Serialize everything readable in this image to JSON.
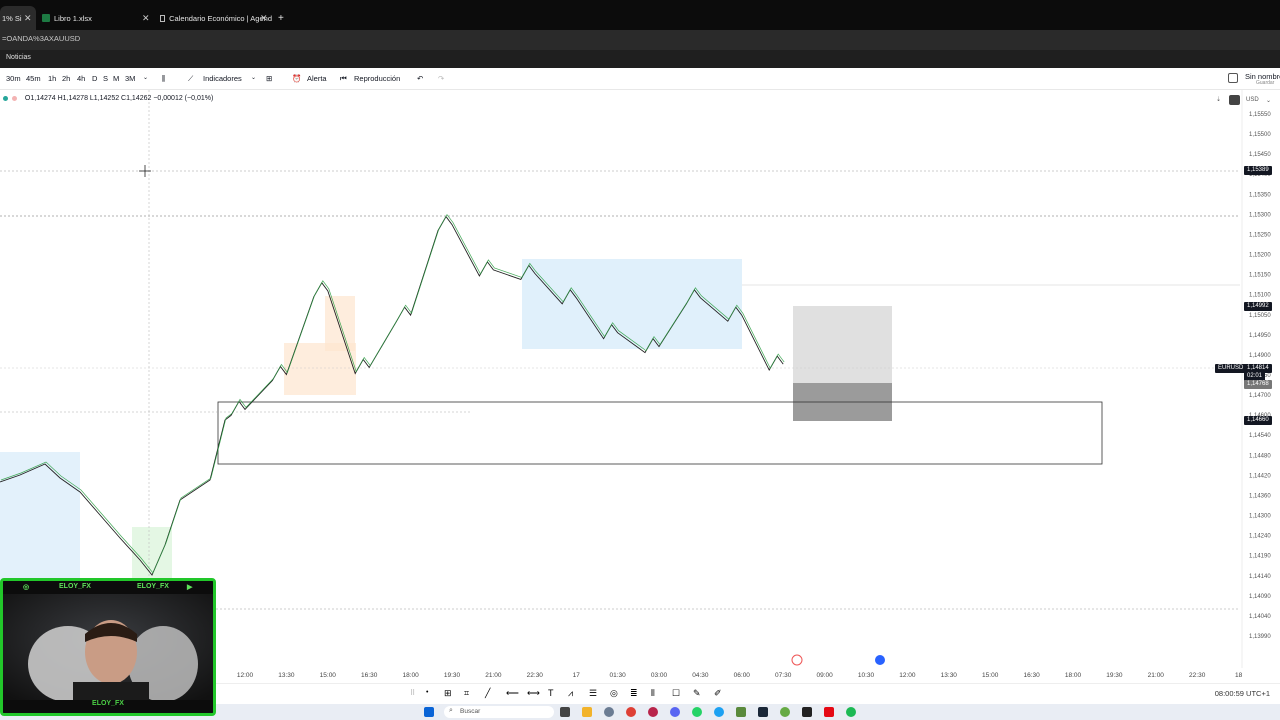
{
  "browser": {
    "tabs": [
      {
        "label": "1% Si",
        "active": true
      },
      {
        "label": "Libro 1.xlsx",
        "active": false
      },
      {
        "label": "Calendario Económico | Agend",
        "active": false
      }
    ],
    "new_tab_label": "+",
    "address": "=OANDA%3AXAUUSD",
    "bookmark": "Noticias"
  },
  "toolbar": {
    "intervals": [
      "30m",
      "45m",
      "1h",
      "2h",
      "4h",
      "D",
      "S",
      "M",
      "3M"
    ],
    "indicators_label": "Indicadores",
    "alert_label": "Alerta",
    "replay_label": "Reproducción",
    "layout_name": "Sin nombre",
    "save_label": "Guardar"
  },
  "legend": {
    "ohlc": "O1,14274 H1,14278 L1,14252 C1,14262 −0,00012 (−0,01%)"
  },
  "price_axis": {
    "currency": "USD",
    "ticks": [
      "1,15550",
      "1,15500",
      "1,15450",
      "1,15400",
      "1,15350",
      "1,15300",
      "1,15250",
      "1,15200",
      "1,15150",
      "1,15100",
      "1,15050",
      "1,14950",
      "1,14900",
      "1,14850",
      "1,14700",
      "1,14600",
      "1,14540",
      "1,14480",
      "1,14420",
      "1,14360",
      "1,14300",
      "1,14240",
      "1,14190",
      "1,14140",
      "1,14090",
      "1,14040",
      "1,13990"
    ],
    "tags": {
      "crosshair": "1,15389",
      "upper": "1,14992",
      "symbol": "EURUSD",
      "current": "1,14814",
      "countdown": "02:01",
      "mid": "1,14768",
      "lower": "1,14660"
    }
  },
  "time_axis": {
    "labels": [
      "12:00",
      "13:30",
      "15:00",
      "16:30",
      "18:00",
      "19:30",
      "21:00",
      "22:30",
      "17",
      "01:30",
      "03:00",
      "04:30",
      "06:00",
      "07:30",
      "09:00",
      "10:30",
      "12:00",
      "13:30",
      "15:00",
      "16:30",
      "18:00",
      "19:30",
      "21:00",
      "22:30",
      "18"
    ]
  },
  "status": {
    "clock": "08:00:59 UTC+1"
  },
  "taskbar": {
    "search_placeholder": "Buscar"
  },
  "webcam": {
    "handle_instagram": "ELOY_FX",
    "handle_tiktok": "ELOY_FX",
    "handle_youtube": "ELOY_FX",
    "name_bottom": "ELOY_FX"
  },
  "chart_data": {
    "type": "candlestick",
    "symbol": "EURUSD",
    "ylim": [
      1.1399,
      1.1555
    ],
    "series": [
      {
        "x": "12:00",
        "y": 1.1468
      },
      {
        "x": "13:30",
        "y": 1.1478
      },
      {
        "x": "15:00",
        "y": 1.1502
      },
      {
        "x": "16:30",
        "y": 1.148
      },
      {
        "x": "18:00",
        "y": 1.1495
      },
      {
        "x": "19:30",
        "y": 1.1521
      },
      {
        "x": "21:00",
        "y": 1.1508
      },
      {
        "x": "22:30",
        "y": 1.1507
      },
      {
        "x": "17",
        "y": 1.15
      },
      {
        "x": "01:30",
        "y": 1.149
      },
      {
        "x": "03:00",
        "y": 1.1486
      },
      {
        "x": "04:30",
        "y": 1.15
      },
      {
        "x": "06:00",
        "y": 1.1495
      },
      {
        "x": "07:30",
        "y": 1.1481
      }
    ]
  }
}
